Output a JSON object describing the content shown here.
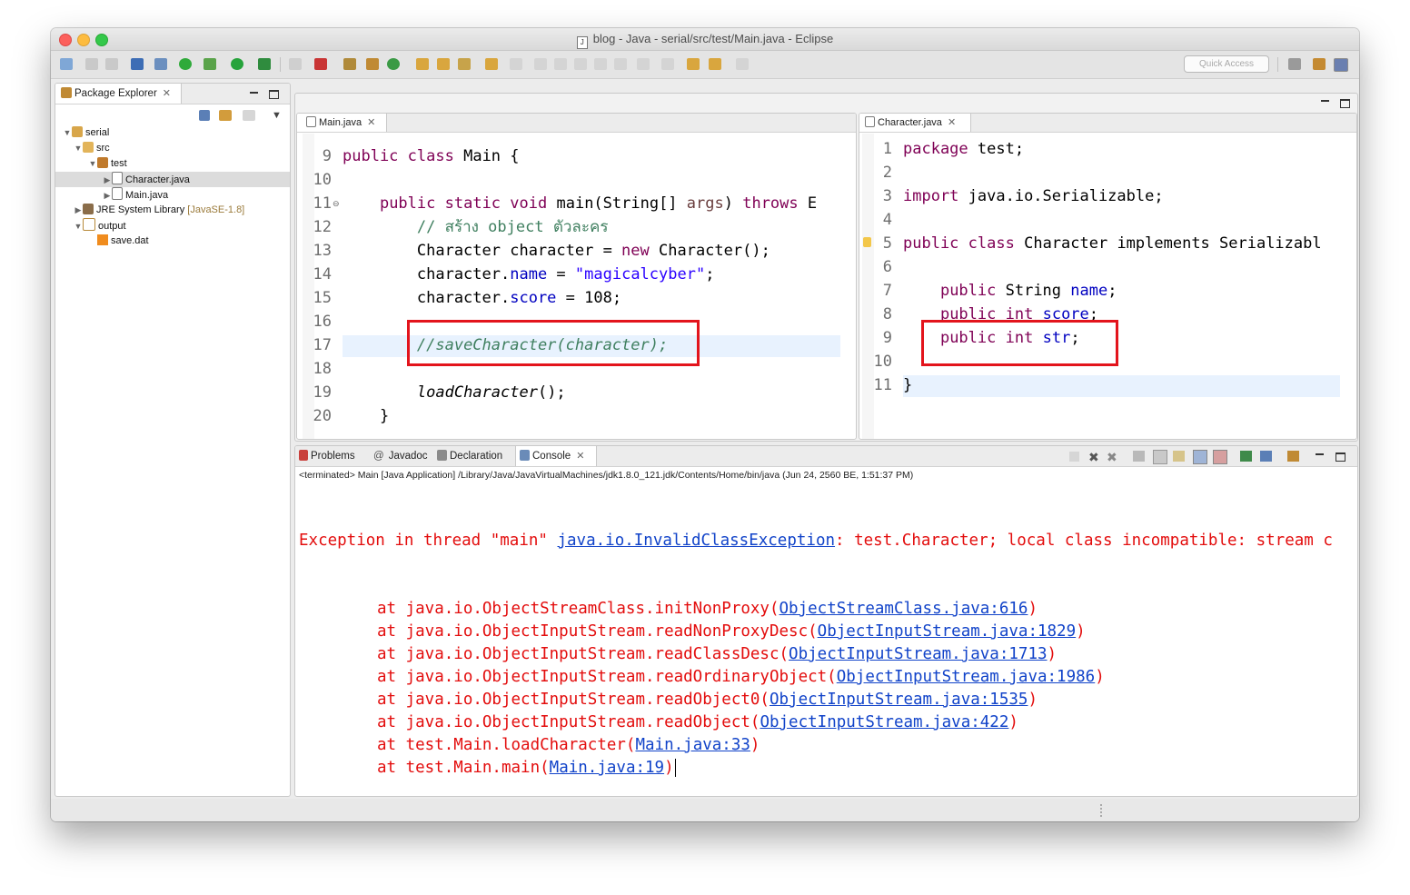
{
  "window": {
    "title": "blog - Java - serial/src/test/Main.java - Eclipse"
  },
  "toolbar": {
    "quick_access_placeholder": "Quick Access"
  },
  "explorer": {
    "tab_label": "Package Explorer",
    "tree": [
      {
        "label": "serial",
        "depth": 0,
        "expanded": true
      },
      {
        "label": "src",
        "depth": 1,
        "expanded": true
      },
      {
        "label": "test",
        "depth": 2,
        "expanded": true
      },
      {
        "label": "Character.java",
        "depth": 3,
        "selected": true
      },
      {
        "label": "Main.java",
        "depth": 3
      },
      {
        "label": "JRE System Library",
        "suffix": "[JavaSE-1.8]",
        "depth": 1
      },
      {
        "label": "output",
        "depth": 1,
        "expanded": true
      },
      {
        "label": "save.dat",
        "depth": 2
      }
    ]
  },
  "editor_main": {
    "tab_label": "Main.java",
    "lines": [
      {
        "n": "9",
        "code": "public class Main {"
      },
      {
        "n": "10",
        "code": ""
      },
      {
        "n": "11",
        "code": "    public static void main(String[] args) throws E"
      },
      {
        "n": "12",
        "code": "        // สร้าง object ตัวละคร"
      },
      {
        "n": "13",
        "code": "        Character character = new Character();"
      },
      {
        "n": "14",
        "code": "        character.name = \"magicalcyber\";"
      },
      {
        "n": "15",
        "code": "        character.score = 108;"
      },
      {
        "n": "16",
        "code": ""
      },
      {
        "n": "17",
        "code": "        //saveCharacter(character);"
      },
      {
        "n": "18",
        "code": ""
      },
      {
        "n": "19",
        "code": "        loadCharacter();"
      },
      {
        "n": "20",
        "code": "    }"
      }
    ]
  },
  "editor_char": {
    "tab_label": "Character.java",
    "lines": [
      {
        "n": "1",
        "code": "package test;"
      },
      {
        "n": "2",
        "code": ""
      },
      {
        "n": "3",
        "code": "import java.io.Serializable;"
      },
      {
        "n": "4",
        "code": ""
      },
      {
        "n": "5",
        "code": "public class Character implements Serializabl"
      },
      {
        "n": "6",
        "code": ""
      },
      {
        "n": "7",
        "code": "    public String name;"
      },
      {
        "n": "8",
        "code": "    public int score;"
      },
      {
        "n": "9",
        "code": "    public int str;"
      },
      {
        "n": "10",
        "code": ""
      },
      {
        "n": "11",
        "code": "}"
      }
    ]
  },
  "bottom_tabs": {
    "problems": "Problems",
    "javadoc": "Javadoc",
    "declaration": "Declaration",
    "console": "Console"
  },
  "console": {
    "header": "<terminated> Main [Java Application] /Library/Java/JavaVirtualMachines/jdk1.8.0_121.jdk/Contents/Home/bin/java (Jun 24, 2560 BE, 1:51:37 PM)",
    "exception_prefix": "Exception in thread \"main\" ",
    "exception_link": "java.io.InvalidClassException",
    "exception_suffix": ": test.Character; local class incompatible: stream c",
    "stack": [
      {
        "method": "at java.io.ObjectStreamClass.initNonProxy(",
        "link": "ObjectStreamClass.java:616"
      },
      {
        "method": "at java.io.ObjectInputStream.readNonProxyDesc(",
        "link": "ObjectInputStream.java:1829"
      },
      {
        "method": "at java.io.ObjectInputStream.readClassDesc(",
        "link": "ObjectInputStream.java:1713"
      },
      {
        "method": "at java.io.ObjectInputStream.readOrdinaryObject(",
        "link": "ObjectInputStream.java:1986"
      },
      {
        "method": "at java.io.ObjectInputStream.readObject0(",
        "link": "ObjectInputStream.java:1535"
      },
      {
        "method": "at java.io.ObjectInputStream.readObject(",
        "link": "ObjectInputStream.java:422"
      },
      {
        "method": "at test.Main.loadCharacter(",
        "link": "Main.java:33"
      },
      {
        "method": "at test.Main.main(",
        "link": "Main.java:19"
      }
    ]
  },
  "colors": {
    "error": "#e30d0d",
    "link": "#1143c9",
    "annotation_box": "#e3141c"
  }
}
